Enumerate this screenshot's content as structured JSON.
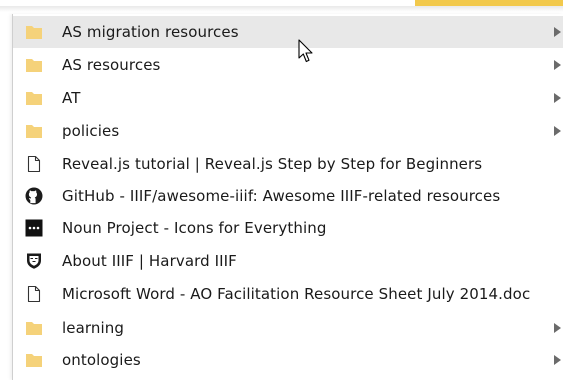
{
  "menu": {
    "items": [
      {
        "label": "AS migration resources",
        "icon": "folder-icon",
        "type": "folder"
      },
      {
        "label": "AS resources",
        "icon": "folder-icon",
        "type": "folder"
      },
      {
        "label": "AT",
        "icon": "folder-icon",
        "type": "folder"
      },
      {
        "label": "policies",
        "icon": "folder-icon",
        "type": "folder"
      },
      {
        "label": "Reveal.js tutorial | Reveal.js Step by Step for Beginners",
        "icon": "page-icon",
        "type": "bookmark"
      },
      {
        "label": "GitHub - IIIF/awesome-iiif: Awesome IIIF-related resources",
        "icon": "github-icon",
        "type": "bookmark"
      },
      {
        "label": "Noun Project - Icons for Everything",
        "icon": "noun-project-icon",
        "type": "bookmark"
      },
      {
        "label": "About IIIF | Harvard IIIF",
        "icon": "harvard-shield-icon",
        "type": "bookmark"
      },
      {
        "label": "Microsoft Word - AO Facilitation Resource Sheet July 2014.doc",
        "icon": "page-icon",
        "type": "bookmark"
      },
      {
        "label": "learning",
        "icon": "folder-icon",
        "type": "folder"
      },
      {
        "label": "ontologies",
        "icon": "folder-icon",
        "type": "folder"
      }
    ]
  },
  "colors": {
    "folder": "#f5d27a",
    "hover": "#e8e8e8",
    "accent": "#f2c94c"
  }
}
